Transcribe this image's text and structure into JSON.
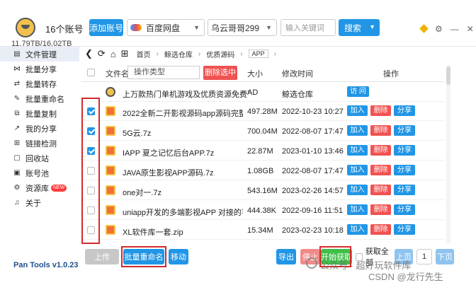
{
  "header": {
    "account_count": "16个账号",
    "storage": "11.79TB/16.02TB",
    "add_account": "添加账号",
    "drive": "百度网盘",
    "user": "乌云哥哥299",
    "search_placeholder": "输入关键词",
    "search_button": "搜索"
  },
  "sidebar": {
    "items": [
      {
        "label": "文件管理",
        "icon": "folder-icon"
      },
      {
        "label": "批量分享",
        "icon": "share-icon"
      },
      {
        "label": "批量转存",
        "icon": "transfer-icon"
      },
      {
        "label": "批量重命名",
        "icon": "rename-icon"
      },
      {
        "label": "批量复制",
        "icon": "copy-icon"
      },
      {
        "label": "我的分享",
        "icon": "my-share-icon"
      },
      {
        "label": "链接检测",
        "icon": "link-check-icon"
      },
      {
        "label": "回收站",
        "icon": "recycle-icon"
      },
      {
        "label": "账号池",
        "icon": "account-pool-icon"
      },
      {
        "label": "资源库",
        "icon": "library-icon"
      },
      {
        "label": "关于",
        "icon": "bell-icon"
      }
    ],
    "new_badge": "NEW",
    "version": "Pan Tools v1.0.23"
  },
  "breadcrumb": {
    "items": [
      "首页",
      "鲸选仓库",
      "优质源码",
      "APP"
    ]
  },
  "table": {
    "col_filename": "文件名",
    "type_select": "操作类型",
    "delete_selected": "删除选中",
    "col_size": "大小",
    "col_modified": "修改时间",
    "col_actions": "操作",
    "rows": [
      {
        "name": "上万款热门单机游戏及优质资源免费下",
        "size": "AD",
        "time": "鲸选仓库",
        "checked": false,
        "actions": [
          "访 问"
        ]
      },
      {
        "name": "2022全新二开影视源码app源码完整版.7",
        "size": "497.28M",
        "time": "2022-10-23 10:27",
        "checked": true,
        "actions": [
          "加入",
          "删除",
          "分享"
        ]
      },
      {
        "name": "5G云.7z",
        "size": "700.04M",
        "time": "2022-08-07 17:47",
        "checked": true,
        "actions": [
          "加入",
          "删除",
          "分享"
        ]
      },
      {
        "name": "IAPP 夏之记忆后台APP.7z",
        "size": "22.87M",
        "time": "2023-01-10 13:46",
        "checked": true,
        "actions": [
          "加入",
          "删除",
          "分享"
        ]
      },
      {
        "name": "JAVA原生影视APP源码.7z",
        "size": "1.08GB",
        "time": "2022-08-07 17:47",
        "checked": false,
        "actions": [
          "加入",
          "删除",
          "分享"
        ]
      },
      {
        "name": "one对一.7z",
        "size": "543.16M",
        "time": "2023-02-26 14:57",
        "checked": false,
        "actions": [
          "加入",
          "删除",
          "分享"
        ]
      },
      {
        "name": "uniapp开发的多端影视APP 对接的苹果",
        "size": "444.38K",
        "time": "2022-09-16 11:51",
        "checked": false,
        "actions": [
          "加入",
          "删除",
          "分享"
        ]
      },
      {
        "name": "XL软件库一套.zip",
        "size": "15.34M",
        "time": "2023-02-23 10:18",
        "checked": false,
        "actions": [
          "加入",
          "删除",
          "分享"
        ]
      }
    ]
  },
  "bottom": {
    "upload": "上传",
    "batch_rename": "批量重命名",
    "move": "移动",
    "export": "导出",
    "stop": "停止",
    "start_fetch": "开始获取",
    "fetch_all": "获取全部",
    "prev": "上页",
    "page": "1",
    "next": "下页"
  },
  "watermarks": {
    "wechat": "公众号 · 超好玩软件库",
    "csdn": "CSDN @龙行先生"
  },
  "colors": {
    "accent": "#2196e6",
    "danger": "#f05252",
    "success": "#3fbf4a",
    "annotation": "#d42a2a"
  }
}
